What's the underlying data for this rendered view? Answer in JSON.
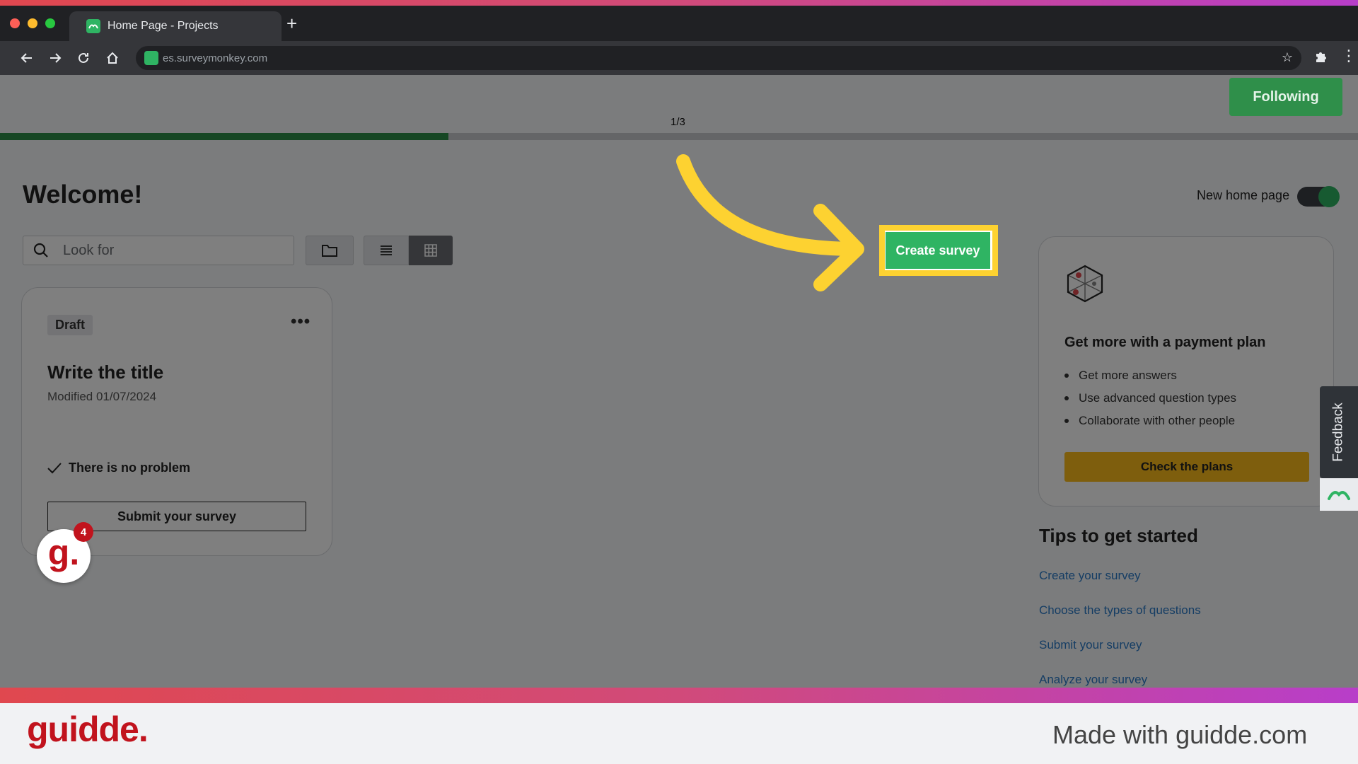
{
  "browser": {
    "tab_title": "Home Page - Projects",
    "url": "es.surveymonkey.com"
  },
  "guide": {
    "step_counter": "1/3",
    "progress": 0.33,
    "following_label": "Following"
  },
  "home": {
    "welcome": "Welcome!",
    "new_home_label": "New home page",
    "new_home_enabled": true,
    "search_placeholder": "Look for",
    "create_survey_label": "Create survey"
  },
  "survey_card": {
    "badge": "Draft",
    "title": "Write the title",
    "modified": "Modified  01/07/2024",
    "status": "There is no problem",
    "submit_label": "Submit your survey"
  },
  "plan_card": {
    "title": "Get more with a payment plan",
    "features": [
      "Get more answers",
      "Use advanced question types",
      "Collaborate with other people"
    ],
    "button_label": "Check the plans"
  },
  "tips": {
    "title": "Tips to get started",
    "links": [
      "Create your survey",
      "Choose the types of questions",
      "Submit your survey",
      "Analyze your survey"
    ]
  },
  "feedback_label": "Feedback",
  "notification_count": "4",
  "footer": {
    "brand": "guidde.",
    "made_with": "Made with guidde.com"
  },
  "colors": {
    "accent_green": "#2fb463",
    "highlight_yellow": "#fdd231",
    "brand_red": "#c1131d",
    "plan_button": "#fdbd1a"
  }
}
